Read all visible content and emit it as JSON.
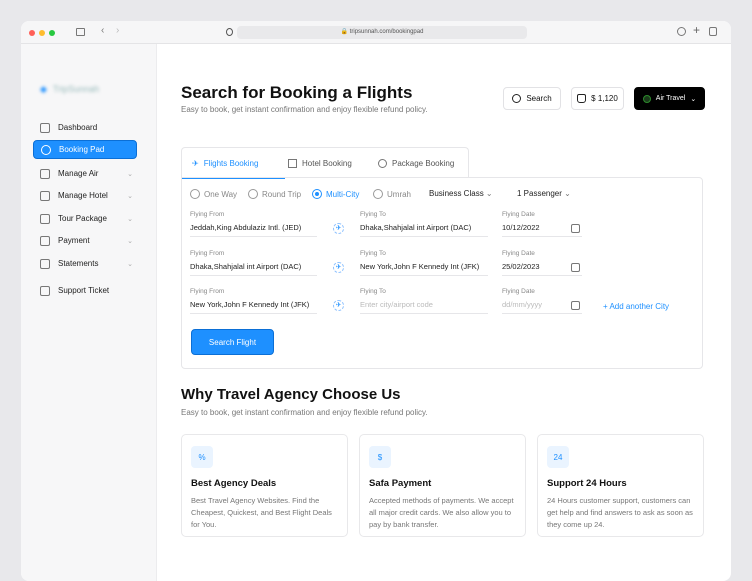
{
  "browser": {
    "url": "tripsunnah.com/bookingpad"
  },
  "sidebar": {
    "logo": "TripSunnah",
    "items": [
      {
        "label": "Dashboard",
        "chev": false
      },
      {
        "label": "Booking Pad",
        "chev": false
      },
      {
        "label": "Manage Air",
        "chev": true
      },
      {
        "label": "Manage Hotel",
        "chev": true
      },
      {
        "label": "Tour Package",
        "chev": true
      },
      {
        "label": "Payment",
        "chev": true
      },
      {
        "label": "Statements",
        "chev": true
      },
      {
        "label": "Support Ticket",
        "chev": false
      }
    ]
  },
  "header": {
    "title": "Search for Booking a Flights",
    "subtitle": "Easy to book, get instant confirmation and enjoy flexible refund policy.",
    "search_label": "Search",
    "balance": "$ 1,120",
    "account": "Air Travel"
  },
  "tabs": [
    "Flights Booking",
    "Hotel Booking",
    "Package Booking"
  ],
  "trip_types": [
    "One Way",
    "Round Trip",
    "Multi-City",
    "Umrah"
  ],
  "selected_trip": "Multi-City",
  "cabin_class": "Business Class",
  "passengers": "1 Passenger",
  "labels": {
    "from": "Flying From",
    "to": "Flying To",
    "date": "Flying Date"
  },
  "rows": [
    {
      "from": "Jeddah,King Abdulaziz Intl. (JED)",
      "to": "Dhaka,Shahjalal int Airport (DAC)",
      "date": "10/12/2022"
    },
    {
      "from": "Dhaka,Shahjalal int Airport (DAC)",
      "to": "New York,John F Kennedy Int (JFK)",
      "date": "25/02/2023"
    },
    {
      "from": "New York,John F Kennedy Int (JFK)",
      "to_placeholder": "Enter city/airport code",
      "date_placeholder": "dd/mm/yyyy"
    }
  ],
  "add_city": "+ Add another City",
  "search_flight": "Search Flight",
  "why": {
    "title": "Why Travel Agency Choose Us",
    "subtitle": "Easy to book, get instant confirmation and enjoy flexible refund policy.",
    "cards": [
      {
        "title": "Best Agency Deals",
        "text": "Best Travel Agency Websites. Find the Cheapest, Quickest, and Best Flight Deals for You.",
        "icon": "%"
      },
      {
        "title": "Safa Payment",
        "text": "Accepted methods of payments. We accept all major credit cards. We also allow you to pay by bank transfer.",
        "icon": "$"
      },
      {
        "title": "Support 24 Hours",
        "text": "24 Hours customer support, customers can get help and find answers to ask as soon as they come up 24.",
        "icon": "24"
      }
    ]
  },
  "colors": {
    "accent": "#1e90ff",
    "dark": "#000000"
  }
}
